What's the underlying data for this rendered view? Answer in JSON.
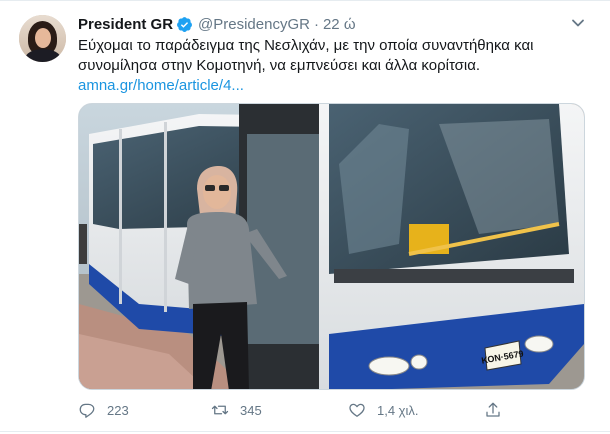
{
  "tweet": {
    "author_name": "President GR",
    "handle": "@PresidencyGR",
    "separator": "·",
    "time": "22 ώ",
    "text_line1": "Εύχομαι το παράδειγμα της Νεσλιχάν, με την οποία συναντήθηκα και",
    "text_line2": "συνομίλησα στην Κομοτηνή, να εμπνεύσει και άλλα κορίτσια.",
    "link": "amna.gr/home/article/4...",
    "bus_plate": "ΚΟΝ·5679",
    "replies": "223",
    "retweets": "345",
    "likes": "1,4 χιλ."
  },
  "colors": {
    "primary_text": "#14171a",
    "secondary_text": "#657786",
    "link": "#1b95e0",
    "verified": "#1da1f2"
  },
  "icons": {
    "verified": "verified-badge-icon",
    "menu": "chevron-down-icon",
    "reply": "reply-icon",
    "retweet": "retweet-icon",
    "like": "heart-icon",
    "share": "share-icon"
  }
}
